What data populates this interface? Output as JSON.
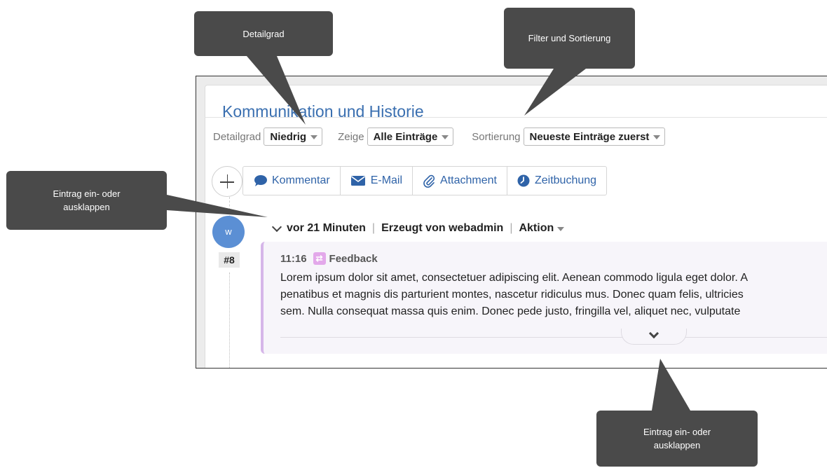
{
  "panel": {
    "title": "Kommunikation und Historie",
    "filters": {
      "detail_label": "Detailgrad",
      "detail_value": "Niedrig",
      "show_label": "Zeige",
      "show_value": "Alle Einträge",
      "sort_label": "Sortierung",
      "sort_value": "Neueste Einträge zuerst"
    },
    "actions": [
      "Kommentar",
      "E-Mail",
      "Attachment",
      "Zeitbuchung"
    ]
  },
  "entry": {
    "avatar": "w",
    "number": "#8",
    "time_ago": "vor 21 Minuten",
    "created_by": "Erzeugt von webadmin",
    "action_label": "Aktion",
    "time": "11:16",
    "type": "Feedback",
    "body_lines": [
      "Lorem ipsum dolor sit amet, consectetuer adipiscing elit. Aenean commodo ligula eget dolor. A",
      "penatibus et magnis dis parturient montes, nascetur ridiculus mus. Donec quam felis, ultricies",
      "sem. Nulla consequat massa quis enim. Donec pede justo, fringilla vel, aliquet nec, vulputate"
    ]
  },
  "callouts": {
    "detail": "Detailgrad",
    "filter_sort": "Filter und Sortierung",
    "toggle_left": "Eintrag ein- oder ausklappen",
    "toggle_bottom": "Eintrag ein- oder ausklappen"
  },
  "colors": {
    "title_blue": "#3a6fb0",
    "link_blue": "#2f63a8",
    "avatar_blue": "#5b8fd4",
    "feedback_purple": "#d6b6e9",
    "callout_bg": "#4a4a4a"
  }
}
